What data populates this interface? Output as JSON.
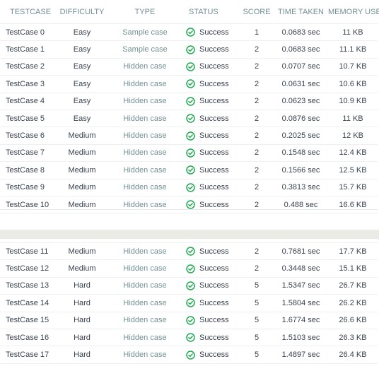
{
  "columns": {
    "testcase": "TESTCASE",
    "difficulty": "DIFFICULTY",
    "type": "TYPE",
    "status": "STATUS",
    "score": "SCORE",
    "time": "TIME TAKEN",
    "memory": "MEMORY USED"
  },
  "status_icon": "check-circle-icon",
  "status_color": "#1ba94c",
  "rows_top": [
    {
      "name": "TestCase 0",
      "difficulty": "Easy",
      "type": "Sample case",
      "status": "Success",
      "score": "1",
      "time": "0.0683 sec",
      "memory": "11 KB"
    },
    {
      "name": "TestCase 1",
      "difficulty": "Easy",
      "type": "Sample case",
      "status": "Success",
      "score": "2",
      "time": "0.0683 sec",
      "memory": "11.1 KB"
    },
    {
      "name": "TestCase 2",
      "difficulty": "Easy",
      "type": "Hidden case",
      "status": "Success",
      "score": "2",
      "time": "0.0707 sec",
      "memory": "10.7 KB"
    },
    {
      "name": "TestCase 3",
      "difficulty": "Easy",
      "type": "Hidden case",
      "status": "Success",
      "score": "2",
      "time": "0.0631 sec",
      "memory": "10.6 KB"
    },
    {
      "name": "TestCase 4",
      "difficulty": "Easy",
      "type": "Hidden case",
      "status": "Success",
      "score": "2",
      "time": "0.0623 sec",
      "memory": "10.9 KB"
    },
    {
      "name": "TestCase 5",
      "difficulty": "Easy",
      "type": "Hidden case",
      "status": "Success",
      "score": "2",
      "time": "0.0876 sec",
      "memory": "11 KB"
    },
    {
      "name": "TestCase 6",
      "difficulty": "Medium",
      "type": "Hidden case",
      "status": "Success",
      "score": "2",
      "time": "0.2025 sec",
      "memory": "12 KB"
    },
    {
      "name": "TestCase 7",
      "difficulty": "Medium",
      "type": "Hidden case",
      "status": "Success",
      "score": "2",
      "time": "0.1548 sec",
      "memory": "12.4 KB"
    },
    {
      "name": "TestCase 8",
      "difficulty": "Medium",
      "type": "Hidden case",
      "status": "Success",
      "score": "2",
      "time": "0.1566 sec",
      "memory": "12.5 KB"
    },
    {
      "name": "TestCase 9",
      "difficulty": "Medium",
      "type": "Hidden case",
      "status": "Success",
      "score": "2",
      "time": "0.3813 sec",
      "memory": "15.7 KB"
    },
    {
      "name": "TestCase 10",
      "difficulty": "Medium",
      "type": "Hidden case",
      "status": "Success",
      "score": "2",
      "time": "0.488 sec",
      "memory": "16.6 KB"
    }
  ],
  "rows_bottom": [
    {
      "name": "TestCase 11",
      "difficulty": "Medium",
      "type": "Hidden case",
      "status": "Success",
      "score": "2",
      "time": "0.7681 sec",
      "memory": "17.7 KB"
    },
    {
      "name": "TestCase 12",
      "difficulty": "Medium",
      "type": "Hidden case",
      "status": "Success",
      "score": "2",
      "time": "0.3448 sec",
      "memory": "15.1 KB"
    },
    {
      "name": "TestCase 13",
      "difficulty": "Hard",
      "type": "Hidden case",
      "status": "Success",
      "score": "5",
      "time": "1.5347 sec",
      "memory": "26.7 KB"
    },
    {
      "name": "TestCase 14",
      "difficulty": "Hard",
      "type": "Hidden case",
      "status": "Success",
      "score": "5",
      "time": "1.5804 sec",
      "memory": "26.2 KB"
    },
    {
      "name": "TestCase 15",
      "difficulty": "Hard",
      "type": "Hidden case",
      "status": "Success",
      "score": "5",
      "time": "1.6774 sec",
      "memory": "26.6 KB"
    },
    {
      "name": "TestCase 16",
      "difficulty": "Hard",
      "type": "Hidden case",
      "status": "Success",
      "score": "5",
      "time": "1.5103 sec",
      "memory": "26.3 KB"
    },
    {
      "name": "TestCase 17",
      "difficulty": "Hard",
      "type": "Hidden case",
      "status": "Success",
      "score": "5",
      "time": "1.4897 sec",
      "memory": "26.4 KB"
    }
  ]
}
